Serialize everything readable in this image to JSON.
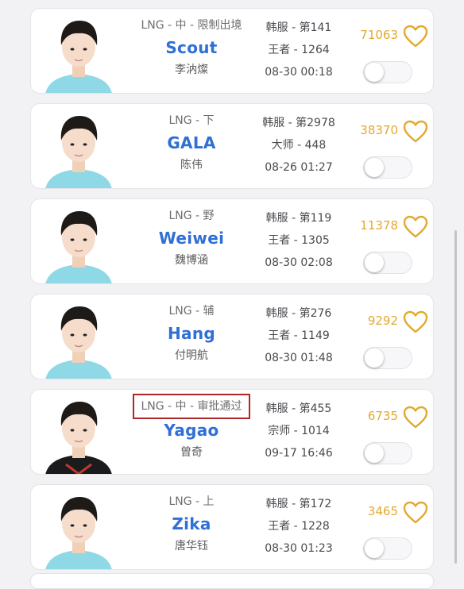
{
  "players": [
    {
      "team_line": "LNG - 中 - 限制出境",
      "ign": "Scout",
      "real_name": "李汭燦",
      "server_rank": "韩服 - 第141",
      "tier": "王者 - 1264",
      "time": "08-30 00:18",
      "score": "71063",
      "jersey_color": "#8fd8e6",
      "highlighted": false
    },
    {
      "team_line": "LNG - 下",
      "ign": "GALA",
      "real_name": "陈伟",
      "server_rank": "韩服 - 第2978",
      "tier": "大师 - 448",
      "time": "08-26 01:27",
      "score": "38370",
      "jersey_color": "#8fd8e6",
      "highlighted": false
    },
    {
      "team_line": "LNG - 野",
      "ign": "Weiwei",
      "real_name": "魏博涵",
      "server_rank": "韩服 - 第119",
      "tier": "王者 - 1305",
      "time": "08-30 02:08",
      "score": "11378",
      "jersey_color": "#8fd8e6",
      "highlighted": false
    },
    {
      "team_line": "LNG - 辅",
      "ign": "Hang",
      "real_name": "付明航",
      "server_rank": "韩服 - 第276",
      "tier": "王者 - 1149",
      "time": "08-30 01:48",
      "score": "9292",
      "jersey_color": "#8fd8e6",
      "highlighted": false
    },
    {
      "team_line": "LNG - 中 - 审批通过",
      "ign": "Yagao",
      "real_name": "曾奇",
      "server_rank": "韩服 - 第455",
      "tier": "宗师 - 1014",
      "time": "09-17 16:46",
      "score": "6735",
      "jersey_color": "#1b1b1d",
      "highlighted": true
    },
    {
      "team_line": "LNG - 上",
      "ign": "Zika",
      "real_name": "唐华钰",
      "server_rank": "韩服 - 第172",
      "tier": "王者 - 1228",
      "time": "08-30 01:23",
      "score": "3465",
      "jersey_color": "#8fd8e6",
      "highlighted": false
    }
  ],
  "colors": {
    "ign": "#2f6fd6",
    "score": "#e3a92e",
    "highlight_box": "#b22525"
  },
  "icons": {
    "favorite": "heart-outline-icon",
    "toggle": "switch-off"
  }
}
